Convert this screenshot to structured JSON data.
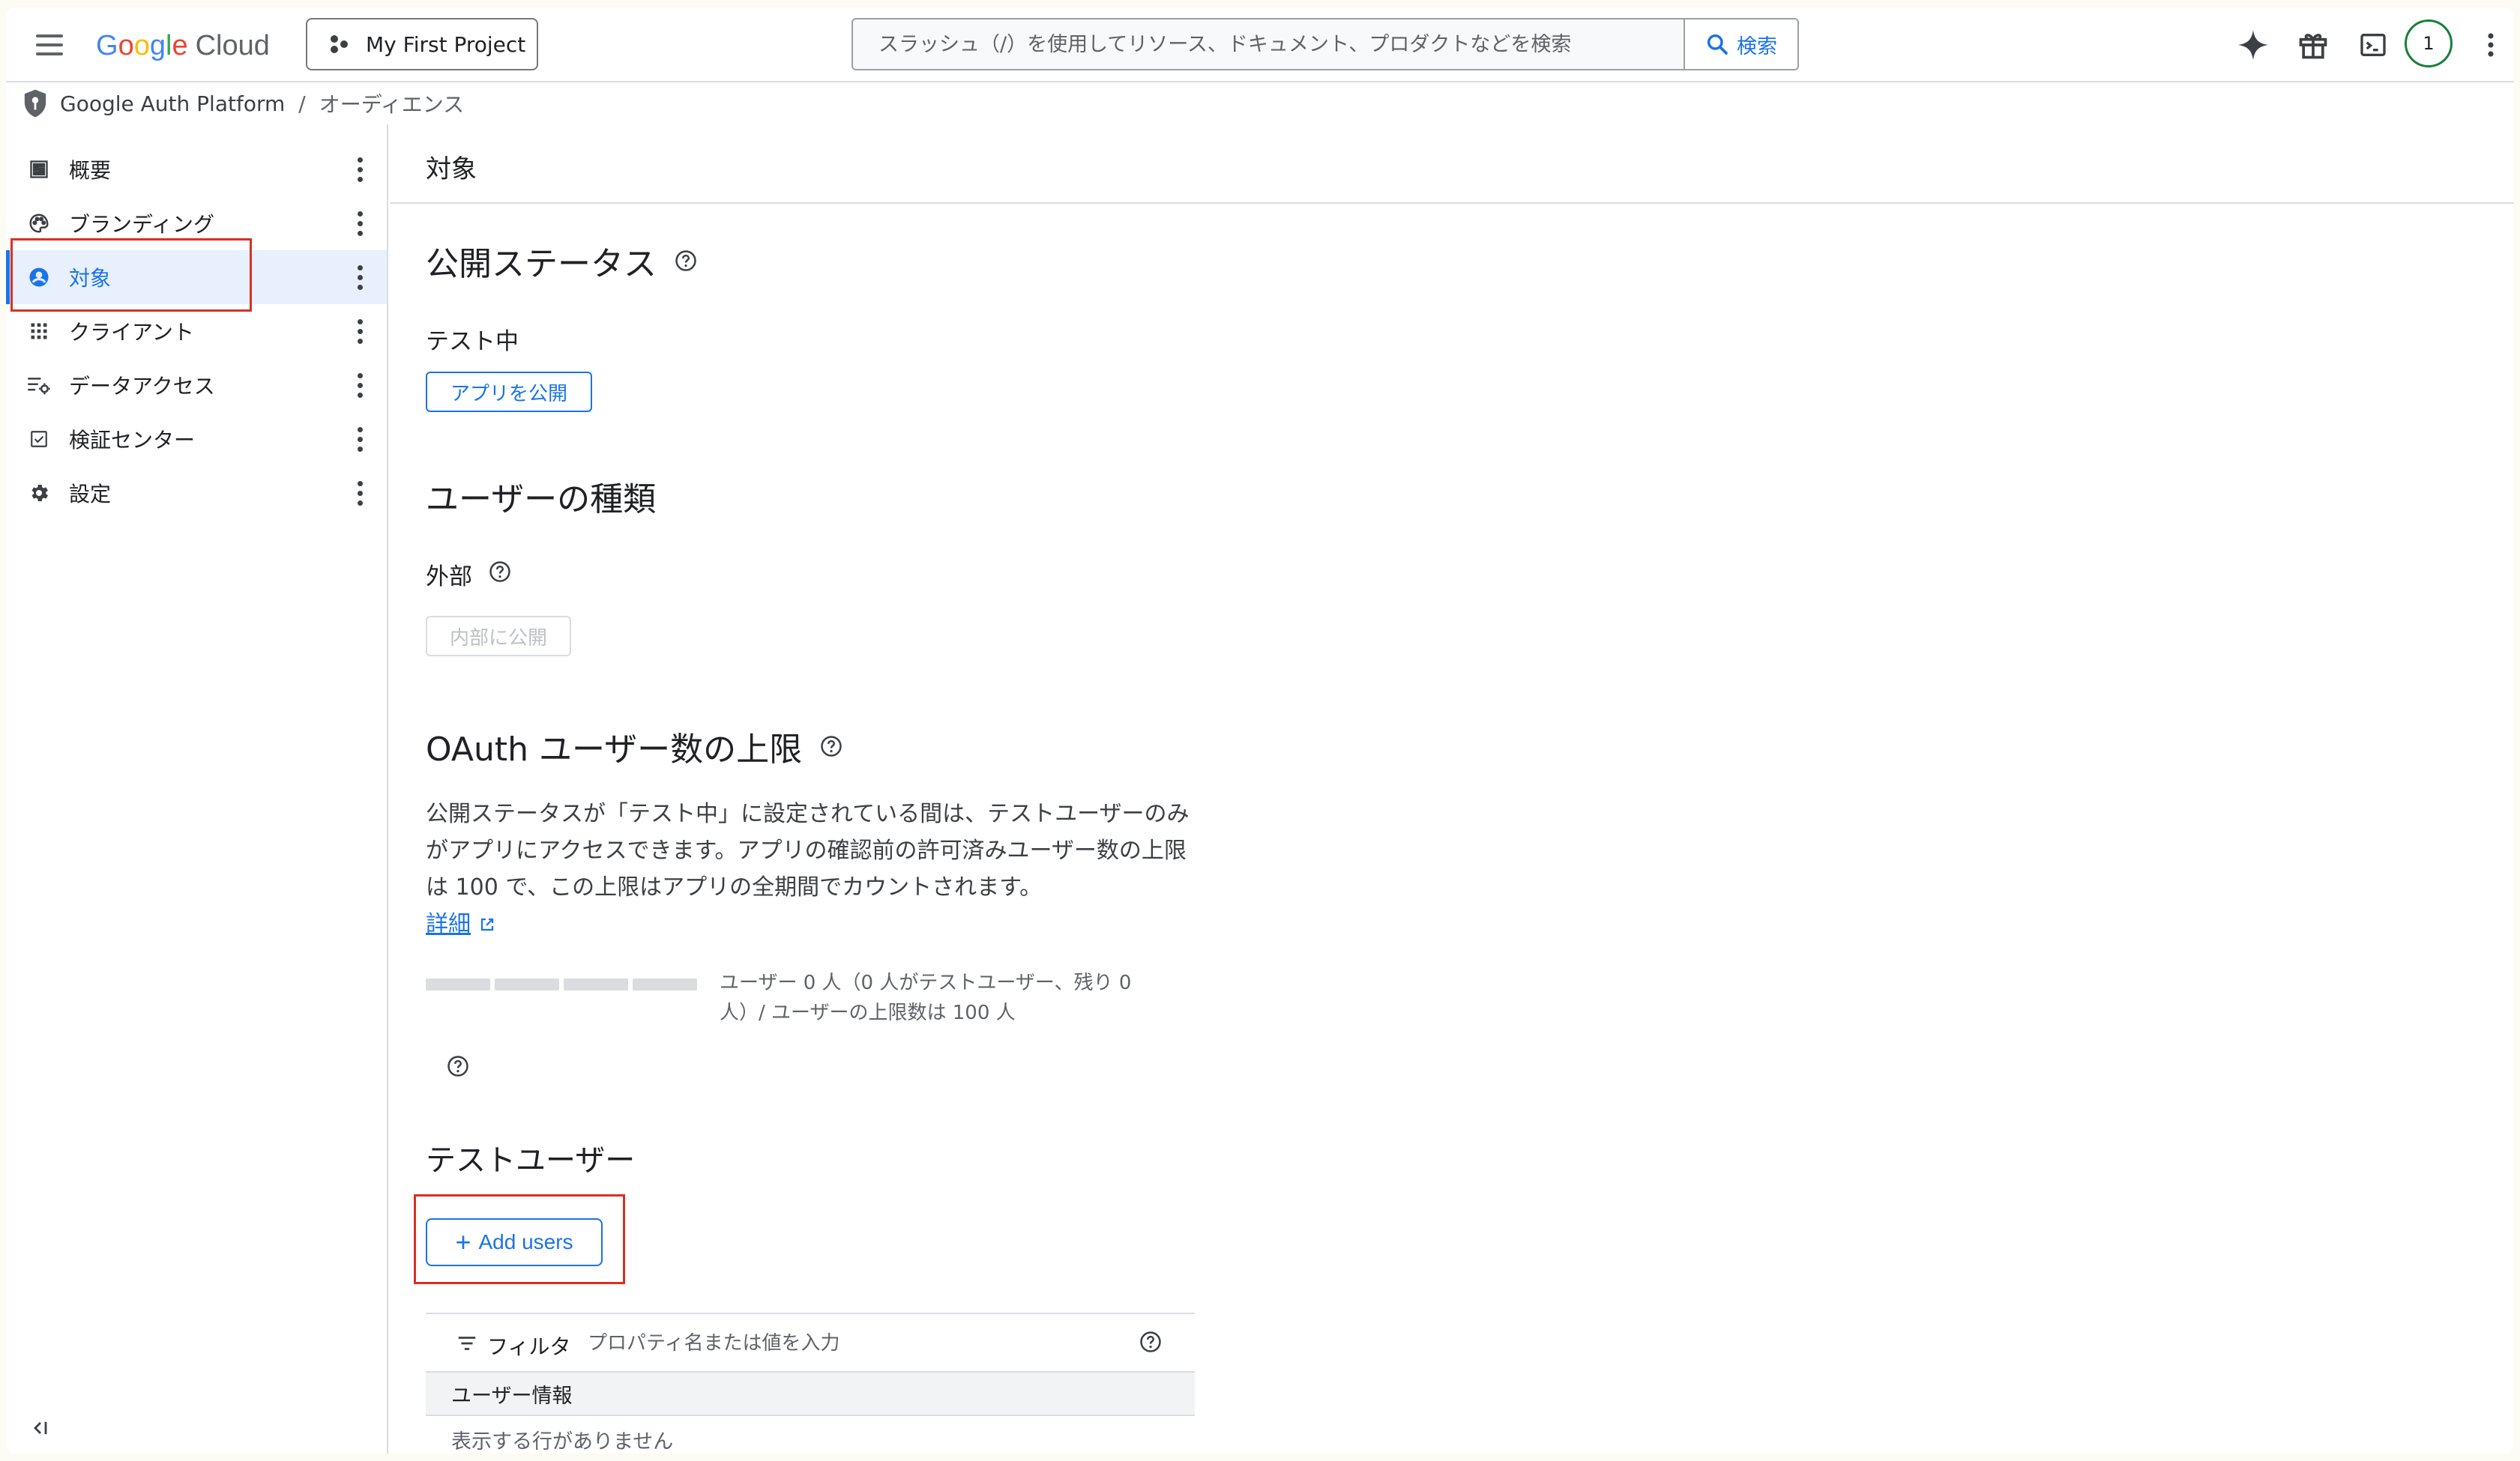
{
  "header": {
    "logo_google": "Google",
    "logo_cloud": "Cloud",
    "project": "My First Project",
    "search_placeholder": "スラッシュ（/）を使用してリソース、ドキュメント、プロダクトなどを検索",
    "search_button": "検索",
    "avatar_text": "1"
  },
  "breadcrumb": {
    "product": "Google Auth Platform",
    "separator": "/",
    "current": "オーディエンス"
  },
  "sidebar": {
    "items": [
      {
        "label": "概要",
        "icon": "dashboard-icon"
      },
      {
        "label": "ブランディング",
        "icon": "palette-icon"
      },
      {
        "label": "対象",
        "icon": "account-circle-icon",
        "active": true
      },
      {
        "label": "クライアント",
        "icon": "apps-grid-icon"
      },
      {
        "label": "データアクセス",
        "icon": "data-settings-icon"
      },
      {
        "label": "検証センター",
        "icon": "verification-icon"
      },
      {
        "label": "設定",
        "icon": "gear-icon"
      }
    ]
  },
  "main": {
    "page_title": "対象",
    "publish": {
      "heading": "公開ステータス",
      "status": "テスト中",
      "button": "アプリを公開"
    },
    "user_type": {
      "heading": "ユーザーの種類",
      "value": "外部",
      "button": "内部に公開"
    },
    "oauth_limit": {
      "heading": "OAuth ユーザー数の上限",
      "description": "公開ステータスが「テスト中」に設定されている間は、テストユーザーのみがアプリにアクセスできます。アプリの確認前の許可済みユーザー数の上限は 100 で、この上限はアプリの全期間でカウントされます。",
      "link": "詳細",
      "progress_fraction": 0,
      "progress_text": "ユーザー 0 人（0 人がテストユーザー、残り 0 人）/ ユーザーの上限数は 100 人"
    },
    "test_users": {
      "heading": "テストユーザー",
      "add_button": "Add users",
      "filter_label": "フィルタ",
      "filter_placeholder": "プロパティ名または値を入力",
      "column_header": "ユーザー情報",
      "empty_message": "表示する行がありません"
    }
  },
  "colors": {
    "accent": "#1a73e8",
    "highlight": "#d93025",
    "active_bg": "#e8f0fe"
  }
}
